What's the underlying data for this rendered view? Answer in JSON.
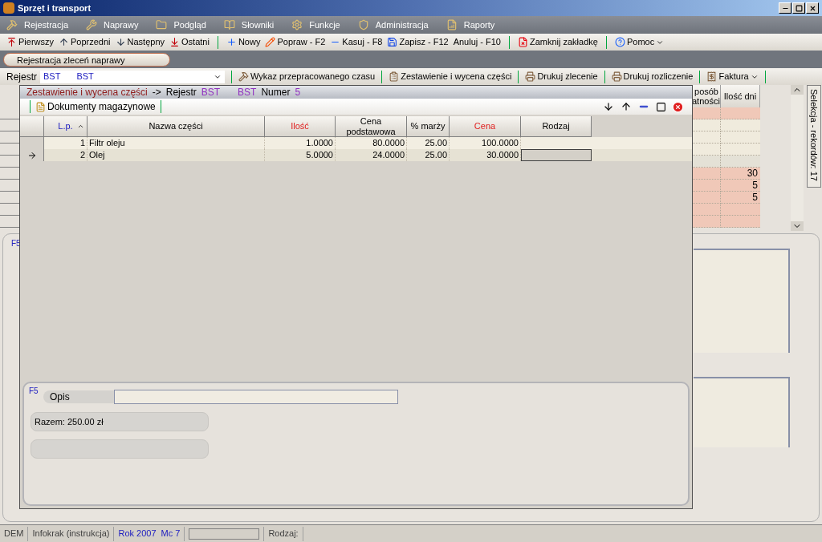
{
  "window": {
    "title": "Sprzęt i transport"
  },
  "menu": [
    "Rejestracja",
    "Naprawy",
    "Podgląd",
    "Słowniki",
    "Funkcje",
    "Administracja",
    "Raporty"
  ],
  "toolbar": [
    [
      {
        "label": "Pierwszy",
        "dropdown": false
      },
      {
        "label": "Poprzedni",
        "dropdown": false
      },
      {
        "label": "Następny",
        "dropdown": false
      },
      {
        "label": "Ostatni",
        "dropdown": false
      }
    ],
    [
      {
        "label": "Nowy",
        "dropdown": false
      },
      {
        "label": "Popraw - F2",
        "dropdown": false
      },
      {
        "label": "Kasuj - F8",
        "dropdown": false
      },
      {
        "label": "Zapisz - F12",
        "dropdown": false
      },
      {
        "label": "Anuluj - F10",
        "dropdown": false
      }
    ],
    [
      {
        "label": "Zamknij zakładkę",
        "dropdown": false
      }
    ],
    [
      {
        "label": "Pomoc",
        "dropdown": true
      }
    ]
  ],
  "tabs": [
    {
      "label": "Rejestracja zleceń naprawy",
      "selected": true
    }
  ],
  "register_bar": {
    "label": "Rejestr",
    "code": "BST",
    "name": "BST",
    "actions": [
      {
        "label": "Wykaz przepracowanego czasu",
        "dropdown": false
      },
      {
        "label": "Zestawienie i wycena części",
        "dropdown": false
      },
      {
        "label": "Drukuj zlecenie",
        "dropdown": false
      },
      {
        "label": "Drukuj rozliczenie",
        "dropdown": false
      },
      {
        "label": "Faktura",
        "dropdown": true
      }
    ]
  },
  "background_list": {
    "columns": [
      [
        "posób",
        "atności"
      ],
      [
        "Ilość dni"
      ]
    ],
    "rows": [
      {
        "color": "#f0c8b8"
      },
      {
        "color": "#f0ebdd"
      },
      {
        "color": "#f0ebdd"
      },
      {
        "color": "#f0ebdd"
      },
      {
        "color": "#e4e1d6"
      },
      {
        "color": "#f0c8b8",
        "days": "30"
      },
      {
        "color": "#f0c8b8",
        "days": "5"
      },
      {
        "color": "#f0c8b8",
        "days": "5"
      },
      {
        "color": "#f0c8b8"
      },
      {
        "color": "#f0c8b8"
      }
    ]
  },
  "side_tab": "Selekcja - rekordów: 17",
  "background_panel": {
    "label": "F5"
  },
  "dialog": {
    "breadcrumb": {
      "module": "Zestawienie i wycena części",
      "arrow": "->",
      "register_label": "Rejestr",
      "code": "BST",
      "name": "BST",
      "number_label": "Numer",
      "number": "5"
    },
    "toolbar_button": "Dokumenty magazynowe",
    "table": {
      "columns": [
        {
          "label": "L.p.",
          "kind": "key",
          "sorted": true
        },
        {
          "label": "Nazwa części",
          "kind": "plain",
          "sorted": false
        },
        {
          "label": "Ilość",
          "kind": "required",
          "sorted": false
        },
        {
          "label": "Cena podstawowa",
          "kind": "plain",
          "sorted": false
        },
        {
          "label": "% marży",
          "kind": "plain",
          "sorted": false
        },
        {
          "label": "Cena",
          "kind": "required",
          "sorted": false
        },
        {
          "label": "Rodzaj",
          "kind": "plain",
          "sorted": false
        }
      ],
      "rows": [
        {
          "selected": false,
          "cells": [
            "1",
            "Filtr oleju",
            "1.0000",
            "80.0000",
            "25.00",
            "100.0000"
          ]
        },
        {
          "selected": true,
          "cells": [
            "2",
            "Olej",
            "5.0000",
            "24.0000",
            "25.00",
            "30.0000"
          ]
        }
      ]
    },
    "footer": {
      "label": "F5",
      "description_label": "Opis",
      "total": "Razem: 250.00 zł"
    }
  },
  "status_bar": [
    {
      "kind": "text",
      "parts": [
        "DEM"
      ]
    },
    {
      "kind": "text",
      "parts": [
        "Infokrak (instrukcja)"
      ]
    },
    {
      "kind": "highlight",
      "parts": [
        "Rok 2007",
        "Mc 7"
      ]
    },
    {
      "kind": "field"
    },
    {
      "kind": "text",
      "parts": [
        "Rodzaj:"
      ]
    }
  ]
}
